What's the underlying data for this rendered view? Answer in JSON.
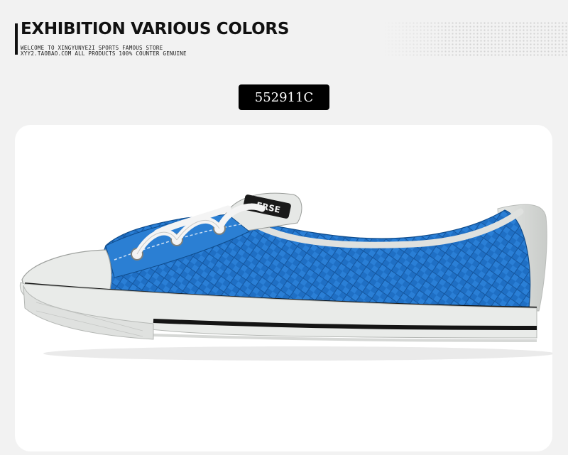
{
  "header": {
    "title": "EXHIBITION VARIOUS COLORS",
    "subtitle_line1": "WELCOME TO XINGYUNYE2I SPORTS FAMOUS STORE",
    "subtitle_line2": "XYY2.TAOBAO.COM ALL PRODUCTS 100% COUNTER GENUINE"
  },
  "product": {
    "code": "552911C",
    "tongue_label": "ERSE"
  },
  "colors": {
    "upper_blue": "#1f6fc4",
    "rubber_white": "#e9ebe9",
    "stripe_black": "#141414",
    "badge_bg": "#000000",
    "page_bg": "#f2f2f2"
  }
}
